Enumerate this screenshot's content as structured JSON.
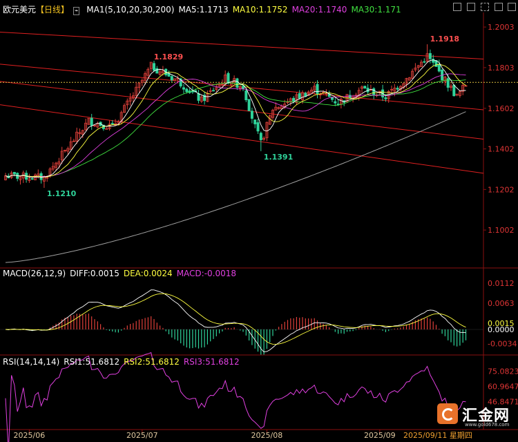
{
  "header": {
    "symbol": "欧元美元",
    "period": "【日线】",
    "ma_title": "MA1(5,10,20,30,200)",
    "ma5": "MA5:1.1713",
    "ma10": "MA10:1.1752",
    "ma20": "MA20:1.1740",
    "ma30": "MA30:1.171"
  },
  "macd_header": {
    "title": "MACD(26,12,9)",
    "diff": "DIFF:0.0015",
    "dea": "DEA:0.0024",
    "macd": "MACD:-0.0018"
  },
  "rsi_header": {
    "title": "RSI(14,14,14)",
    "rsi1": "RSI1:51.6812",
    "rsi2": "RSI2:51.6812",
    "rsi3": "RSI3:51.6812"
  },
  "logo": {
    "name": "汇金网",
    "url": "www.gold678.com"
  },
  "colors": {
    "up": "#e0403a",
    "down": "#2fd39a",
    "ma5": "#ffffff",
    "ma10": "#ffff40",
    "ma20": "#e040e0",
    "ma30": "#40e040",
    "ma200": "#a0a0a0",
    "axis_text": "#e03535",
    "bg": "#000000",
    "channel": "#e02020",
    "label_high": "#ff5050",
    "label_low": "#2fd39a"
  },
  "chart_data": {
    "type": "candlestick",
    "price_axis": {
      "ticks": [
        "1.2003",
        "1.1803",
        "1.1602",
        "1.1402",
        "1.1202",
        "1.1002"
      ],
      "values": [
        1.2003,
        1.1803,
        1.1602,
        1.1402,
        1.1202,
        1.1002
      ],
      "ylim": [
        1.0815,
        1.2075
      ]
    },
    "x_labels": [
      "2025/06",
      "2025/07",
      "2025/08",
      "2025/09"
    ],
    "x_label_index": [
      8,
      46,
      88,
      126
    ],
    "last_date": "2025/09/11 星期四",
    "current_price": 1.173,
    "annotations": [
      {
        "text": "1.1829",
        "index": 49,
        "value": 1.1829,
        "kind": "high"
      },
      {
        "text": "1.1918",
        "index": 142,
        "value": 1.1918,
        "kind": "high"
      },
      {
        "text": "1.1210",
        "index": 13,
        "value": 1.121,
        "kind": "low"
      },
      {
        "text": "1.1391",
        "index": 86,
        "value": 1.1391,
        "kind": "low"
      }
    ],
    "key_points": [
      [
        0,
        1.127
      ],
      [
        13,
        1.126
      ],
      [
        28,
        1.154
      ],
      [
        36,
        1.151
      ],
      [
        44,
        1.169
      ],
      [
        49,
        1.181
      ],
      [
        58,
        1.174
      ],
      [
        66,
        1.164
      ],
      [
        74,
        1.175
      ],
      [
        80,
        1.171
      ],
      [
        84,
        1.151
      ],
      [
        86,
        1.143
      ],
      [
        90,
        1.16
      ],
      [
        96,
        1.164
      ],
      [
        104,
        1.17
      ],
      [
        112,
        1.163
      ],
      [
        120,
        1.17
      ],
      [
        128,
        1.166
      ],
      [
        135,
        1.175
      ],
      [
        142,
        1.186
      ],
      [
        148,
        1.174
      ],
      [
        152,
        1.166
      ],
      [
        155,
        1.172
      ]
    ],
    "macd_axis": {
      "ticks": [
        "0.0112",
        "0.0063",
        "0.0015",
        "0.0000",
        "-0.0034"
      ],
      "values": [
        0.0112,
        0.0063,
        0.0015,
        0.0,
        -0.0034
      ],
      "ylim": [
        -0.006,
        0.0125
      ]
    },
    "rsi_axis": {
      "ticks": [
        "75.0823",
        "60.9647",
        "46.8471"
      ],
      "values": [
        75.0823,
        60.9647,
        46.8471
      ],
      "ylim": [
        22,
        80
      ]
    }
  }
}
